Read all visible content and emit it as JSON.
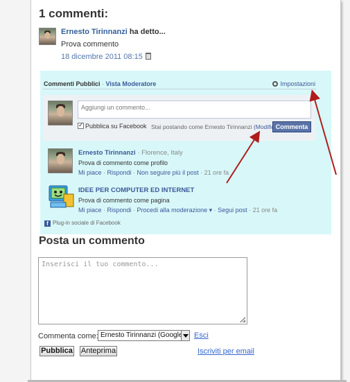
{
  "comments_heading": "1 commenti:",
  "comment": {
    "author": "Ernesto Tirinnanzi",
    "said": "ha detto...",
    "text": "Prova commento",
    "date": "18 dicembre 2011 08:15"
  },
  "fb": {
    "tabs": [
      "Commenti Pubblici",
      "Vista Moderatore"
    ],
    "settings": "Impostazioni",
    "input_placeholder": "Aggiungi un commento...",
    "share_fb": "Pubblica su Facebook",
    "posting_as": "Stai postando come Ernesto Tirinnanzi",
    "modify": "(Modifica)",
    "comment_button": "Commenta",
    "comments": [
      {
        "name": "Ernesto Tirinnanzi",
        "location": "· Florence, Italy",
        "text": "Prova di commento come profilo",
        "actions": [
          "Mi piace",
          "Rispondi",
          "Non seguire più il post"
        ],
        "time": "21 ore fa"
      },
      {
        "name": "IDEE PER COMPUTER ED INTERNET",
        "location": "",
        "text": "Prova di commento come pagina",
        "actions": [
          "Mi piace",
          "Rispondi",
          "Procedi alla moderazione ▾",
          "Segui post"
        ],
        "time": "21 ore fa"
      }
    ],
    "footer": "Plug-in sociale di Facebook"
  },
  "post_form": {
    "heading": "Posta un commento",
    "placeholder": "Inserisci il tuo commento...",
    "comment_as_label": "Commenta come:",
    "comment_as_value": "Ernesto Tirinnanzi (Google)",
    "exit": "Esci",
    "publish": "Pubblica",
    "preview": "Anteprima",
    "subscribe": "Iscriviti per email"
  },
  "colors": {
    "fb_panel": "#d8f7f9",
    "fb_blue": "#3b5998",
    "arrow": "#b01c1c"
  }
}
